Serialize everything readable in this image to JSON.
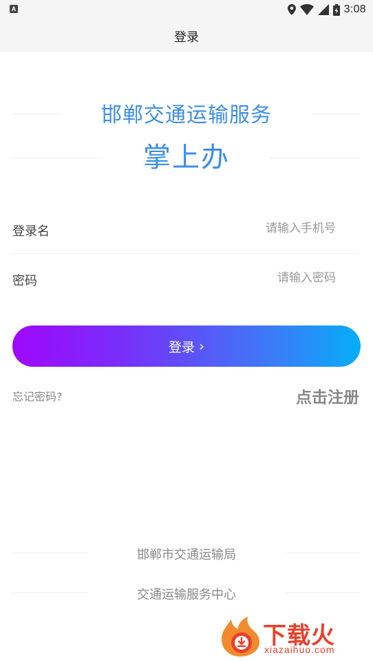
{
  "status_bar": {
    "app_icon_glyph": "A",
    "time": "3:08"
  },
  "header": {
    "title": "登录"
  },
  "hero": {
    "line1": "邯郸交通运输服务",
    "line2": "掌上办",
    "color": "#3d8ee8"
  },
  "form": {
    "username": {
      "label": "登录名",
      "placeholder": "请输入手机号",
      "value": ""
    },
    "password": {
      "label": "密码",
      "placeholder": "请输入密码",
      "value": ""
    }
  },
  "actions": {
    "login_label": "登录",
    "login_chevron": "›",
    "forgot_label": "忘记密码?",
    "register_label": "点击注册",
    "gradient_start": "#a007fc",
    "gradient_end": "#05aef9"
  },
  "footer": {
    "line1": "邯郸市交通运输局",
    "line2": "交通运输服务中心"
  },
  "watermark": {
    "name": "下载火",
    "domain": "xiazaihuo.com",
    "color": "#e8402c"
  }
}
